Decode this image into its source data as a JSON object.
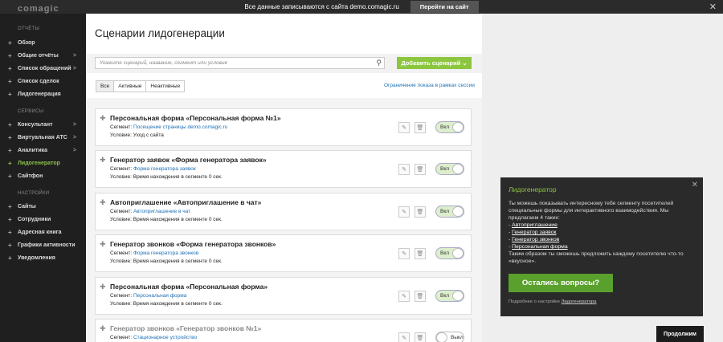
{
  "topbar": {
    "notice": "Все данные записываются с сайта demo.comagic.ru",
    "go_btn": "Перейти на сайт",
    "close": "✕"
  },
  "logo": "comagic",
  "sidebar": {
    "sections": [
      {
        "label": "ОТЧЁТЫ"
      },
      {
        "label": "СЕРВИСЫ"
      },
      {
        "label": "НАСТРОЙКИ"
      }
    ],
    "items": [
      {
        "label": "Обзор",
        "icon": "plus-icon"
      },
      {
        "label": "Общие отчёты",
        "icon": "plus-icon",
        "chevron": ">"
      },
      {
        "label": "Список обращений",
        "icon": "plus-icon",
        "chevron": ">"
      },
      {
        "label": "Список сделок",
        "icon": "plus-icon"
      },
      {
        "label": "Лидогенерация",
        "icon": "plus-icon"
      },
      {
        "label": "Консультант",
        "icon": "plus-icon",
        "chevron": ">"
      },
      {
        "label": "Виртуальная АТС",
        "icon": "plus-icon",
        "chevron": ">"
      },
      {
        "label": "Аналитика",
        "icon": "plus-icon",
        "chevron": ">"
      },
      {
        "label": "Лидогенератор",
        "icon": "plus-icon",
        "active": true
      },
      {
        "label": "Сайтфон",
        "icon": "plus-icon"
      },
      {
        "label": "Сайты",
        "icon": "plus-icon"
      },
      {
        "label": "Сотрудники",
        "icon": "plus-icon"
      },
      {
        "label": "Адресная книга",
        "icon": "plus-icon"
      },
      {
        "label": "Графики активности",
        "icon": "plus-icon"
      },
      {
        "label": "Уведомления",
        "icon": "plus-icon"
      }
    ]
  },
  "main": {
    "title": "Сценарии лидогенерации",
    "search_placeholder": "Укажите сценарий, название, сегмент или условие",
    "add_btn": "Добавить сценарий ⌄",
    "tabs": [
      "Все",
      "Активные",
      "Неактивные"
    ],
    "limit_link": "Ограничение показа в рамках сессии",
    "seg_label": "Сегмент:",
    "cards": [
      {
        "name": "Персональная форма «Персональная форма №1»",
        "segment": "Посещение страницы demo.comagic.ru",
        "condition": "Условие: Уход с сайта",
        "toggle": "Вкл"
      },
      {
        "name": "Генератор заявок «Форма генератора заявок»",
        "segment": "Форма генератора заявок",
        "condition": "Условие: Время нахождения в сегменте 0 сек.",
        "toggle": "Вкл"
      },
      {
        "name": "Автоприглашение «Автоприглашение в чат»",
        "segment": "Автоприглашение в чат",
        "condition": "Условие: Время нахождения в сегменте 0 сек.",
        "toggle": "Вкл"
      },
      {
        "name": "Генератор звонков «Форма генератора звонков»",
        "segment": "Форма генератора звонков",
        "condition": "Условие: Время нахождения в сегменте 0 сек.",
        "toggle": "Вкл"
      },
      {
        "name": "Персональная форма «Персональная форма»",
        "segment": "Персональная форма",
        "condition": "Условие: Время нахождения в сегменте 0 сек.",
        "toggle": "Вкл"
      },
      {
        "name": "Генератор звонков «Генератор звонков №1»",
        "segment": "Стационарное устройство",
        "condition": "",
        "toggle": "Выкл"
      }
    ]
  },
  "popup": {
    "title": "Лидогенератор",
    "intro": "Ты можешь показывать интересному тебе сегменту посетителей специальные формы для интерактивного взаимодействия. Мы предлагаем 4 таких:",
    "links": [
      "Автоприглашение",
      "Генератор заявок",
      "Генератор звонков",
      "Персональная форма"
    ],
    "outro": "Таким образом ты сможешь предложить каждому посетителю что-то «вкусное».",
    "button": "Остались вопросы?",
    "foot_text": "Подробнее о настройке",
    "foot_link": "Лидогенератора",
    "close": "✕"
  },
  "continue_btn": "Продолжим",
  "colors": {
    "accent": "#8cc63f",
    "link": "#1e6fb5",
    "sidebar_bg": "#1f1f1f"
  }
}
